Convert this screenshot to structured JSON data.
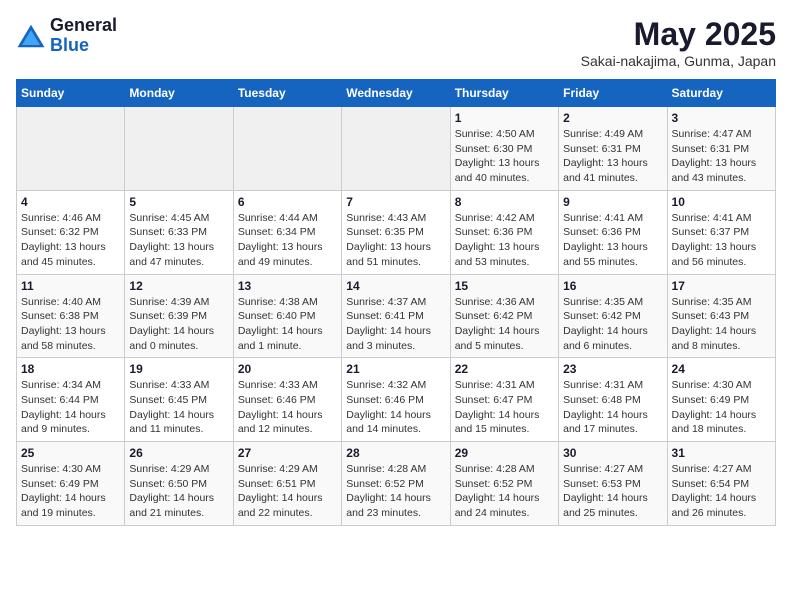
{
  "logo": {
    "general": "General",
    "blue": "Blue"
  },
  "header": {
    "month": "May 2025",
    "location": "Sakai-nakajima, Gunma, Japan"
  },
  "weekdays": [
    "Sunday",
    "Monday",
    "Tuesday",
    "Wednesday",
    "Thursday",
    "Friday",
    "Saturday"
  ],
  "weeks": [
    [
      {
        "day": "",
        "info": ""
      },
      {
        "day": "",
        "info": ""
      },
      {
        "day": "",
        "info": ""
      },
      {
        "day": "",
        "info": ""
      },
      {
        "day": "1",
        "info": "Sunrise: 4:50 AM\nSunset: 6:30 PM\nDaylight: 13 hours\nand 40 minutes."
      },
      {
        "day": "2",
        "info": "Sunrise: 4:49 AM\nSunset: 6:31 PM\nDaylight: 13 hours\nand 41 minutes."
      },
      {
        "day": "3",
        "info": "Sunrise: 4:47 AM\nSunset: 6:31 PM\nDaylight: 13 hours\nand 43 minutes."
      }
    ],
    [
      {
        "day": "4",
        "info": "Sunrise: 4:46 AM\nSunset: 6:32 PM\nDaylight: 13 hours\nand 45 minutes."
      },
      {
        "day": "5",
        "info": "Sunrise: 4:45 AM\nSunset: 6:33 PM\nDaylight: 13 hours\nand 47 minutes."
      },
      {
        "day": "6",
        "info": "Sunrise: 4:44 AM\nSunset: 6:34 PM\nDaylight: 13 hours\nand 49 minutes."
      },
      {
        "day": "7",
        "info": "Sunrise: 4:43 AM\nSunset: 6:35 PM\nDaylight: 13 hours\nand 51 minutes."
      },
      {
        "day": "8",
        "info": "Sunrise: 4:42 AM\nSunset: 6:36 PM\nDaylight: 13 hours\nand 53 minutes."
      },
      {
        "day": "9",
        "info": "Sunrise: 4:41 AM\nSunset: 6:36 PM\nDaylight: 13 hours\nand 55 minutes."
      },
      {
        "day": "10",
        "info": "Sunrise: 4:41 AM\nSunset: 6:37 PM\nDaylight: 13 hours\nand 56 minutes."
      }
    ],
    [
      {
        "day": "11",
        "info": "Sunrise: 4:40 AM\nSunset: 6:38 PM\nDaylight: 13 hours\nand 58 minutes."
      },
      {
        "day": "12",
        "info": "Sunrise: 4:39 AM\nSunset: 6:39 PM\nDaylight: 14 hours\nand 0 minutes."
      },
      {
        "day": "13",
        "info": "Sunrise: 4:38 AM\nSunset: 6:40 PM\nDaylight: 14 hours\nand 1 minute."
      },
      {
        "day": "14",
        "info": "Sunrise: 4:37 AM\nSunset: 6:41 PM\nDaylight: 14 hours\nand 3 minutes."
      },
      {
        "day": "15",
        "info": "Sunrise: 4:36 AM\nSunset: 6:42 PM\nDaylight: 14 hours\nand 5 minutes."
      },
      {
        "day": "16",
        "info": "Sunrise: 4:35 AM\nSunset: 6:42 PM\nDaylight: 14 hours\nand 6 minutes."
      },
      {
        "day": "17",
        "info": "Sunrise: 4:35 AM\nSunset: 6:43 PM\nDaylight: 14 hours\nand 8 minutes."
      }
    ],
    [
      {
        "day": "18",
        "info": "Sunrise: 4:34 AM\nSunset: 6:44 PM\nDaylight: 14 hours\nand 9 minutes."
      },
      {
        "day": "19",
        "info": "Sunrise: 4:33 AM\nSunset: 6:45 PM\nDaylight: 14 hours\nand 11 minutes."
      },
      {
        "day": "20",
        "info": "Sunrise: 4:33 AM\nSunset: 6:46 PM\nDaylight: 14 hours\nand 12 minutes."
      },
      {
        "day": "21",
        "info": "Sunrise: 4:32 AM\nSunset: 6:46 PM\nDaylight: 14 hours\nand 14 minutes."
      },
      {
        "day": "22",
        "info": "Sunrise: 4:31 AM\nSunset: 6:47 PM\nDaylight: 14 hours\nand 15 minutes."
      },
      {
        "day": "23",
        "info": "Sunrise: 4:31 AM\nSunset: 6:48 PM\nDaylight: 14 hours\nand 17 minutes."
      },
      {
        "day": "24",
        "info": "Sunrise: 4:30 AM\nSunset: 6:49 PM\nDaylight: 14 hours\nand 18 minutes."
      }
    ],
    [
      {
        "day": "25",
        "info": "Sunrise: 4:30 AM\nSunset: 6:49 PM\nDaylight: 14 hours\nand 19 minutes."
      },
      {
        "day": "26",
        "info": "Sunrise: 4:29 AM\nSunset: 6:50 PM\nDaylight: 14 hours\nand 21 minutes."
      },
      {
        "day": "27",
        "info": "Sunrise: 4:29 AM\nSunset: 6:51 PM\nDaylight: 14 hours\nand 22 minutes."
      },
      {
        "day": "28",
        "info": "Sunrise: 4:28 AM\nSunset: 6:52 PM\nDaylight: 14 hours\nand 23 minutes."
      },
      {
        "day": "29",
        "info": "Sunrise: 4:28 AM\nSunset: 6:52 PM\nDaylight: 14 hours\nand 24 minutes."
      },
      {
        "day": "30",
        "info": "Sunrise: 4:27 AM\nSunset: 6:53 PM\nDaylight: 14 hours\nand 25 minutes."
      },
      {
        "day": "31",
        "info": "Sunrise: 4:27 AM\nSunset: 6:54 PM\nDaylight: 14 hours\nand 26 minutes."
      }
    ]
  ]
}
